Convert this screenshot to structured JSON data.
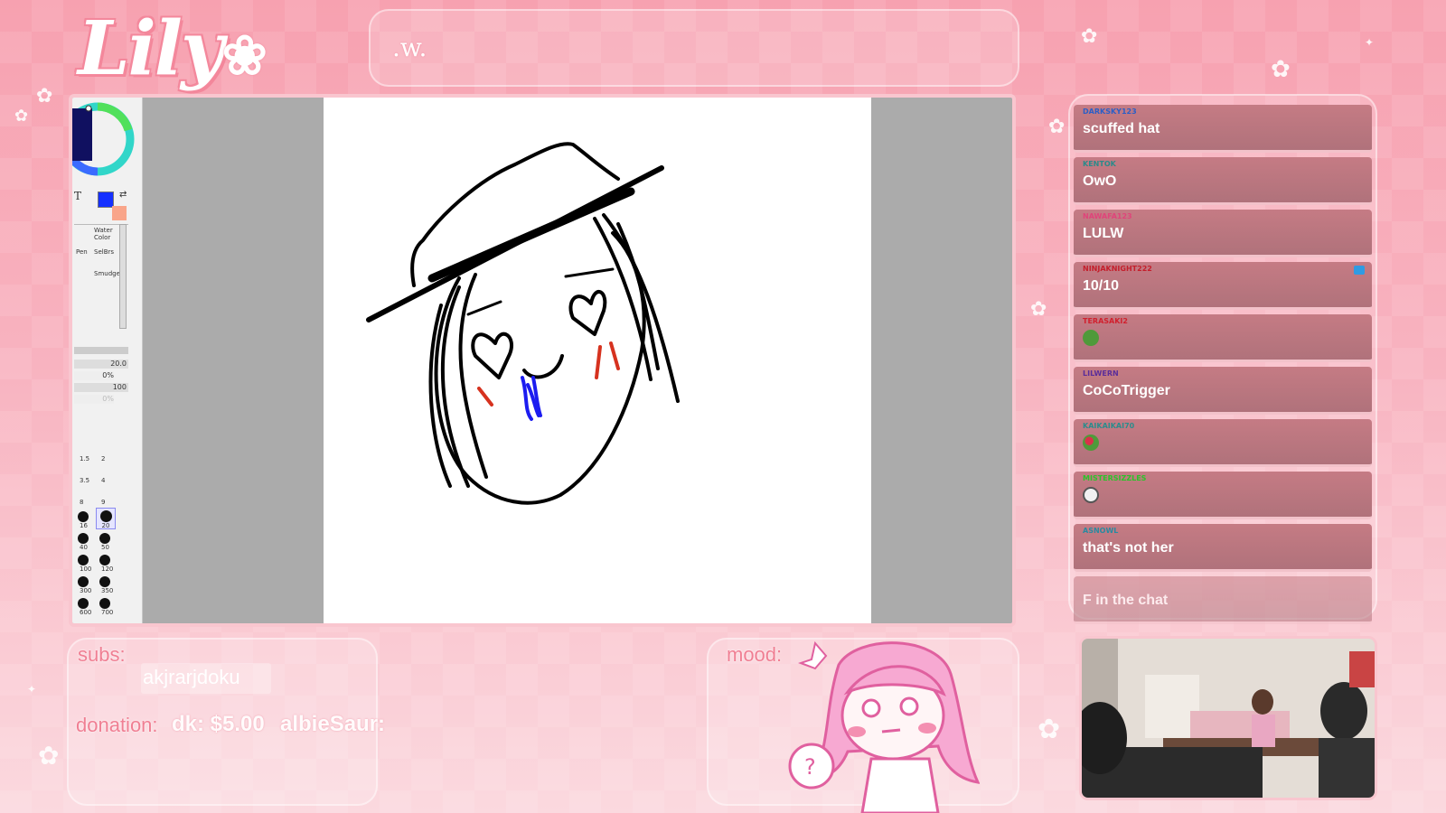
{
  "overlay": {
    "logo_text": "Lily",
    "title_text": ".w.",
    "subs_label": "subs:",
    "latest_sub": "akjrarjdoku",
    "donation_label": "donation:",
    "donation_entry": "dk: $5.00",
    "donation_entry_2": "albieSaur:",
    "mood_label": "mood:",
    "mood_bubble": "?"
  },
  "paint_app": {
    "tools": [
      "T",
      "Water Color",
      "Pen",
      "SelBrs",
      "Smudge"
    ],
    "brush_size": "20.0",
    "density": "100",
    "opacity_1": "0%",
    "opacity_2": "0%",
    "brush_sizes": [
      "1.5",
      "2",
      "3.5",
      "4",
      "8",
      "9",
      "16",
      "20",
      "40",
      "50",
      "100",
      "120",
      "300",
      "350",
      "600",
      "700"
    ],
    "primary_color": "#1530ff",
    "secondary_color": "#f9a58a"
  },
  "chat": {
    "messages": [
      {
        "user": "DARKSKY123",
        "text": "scuffed hat",
        "user_color": "#2b5fc7"
      },
      {
        "user": "KENTOK",
        "text": "OwO",
        "user_color": "#2b8a8a"
      },
      {
        "user": "NAWAFA123",
        "text": "LULW",
        "user_color": "#e0447a"
      },
      {
        "user": "NINJAKNIGHT222",
        "text": "10/10",
        "user_color": "#c41f2c"
      },
      {
        "user": "TERASAKI2",
        "text": "",
        "user_color": "#d1202e",
        "emote": "pepe-emote"
      },
      {
        "user": "LILWERN",
        "text": "CoCoTrigger",
        "user_color": "#5a2d9a"
      },
      {
        "user": "KAIKAIKAI70",
        "text": "",
        "user_color": "#2c8c8c",
        "emote": "pepe-rose-emote"
      },
      {
        "user": "MISTERSIZZLES",
        "text": "",
        "user_color": "#2ac42a",
        "emote": "white-face-emote"
      },
      {
        "user": "ASNOWL",
        "text": "that's not her",
        "user_color": "#2a8aa0"
      },
      {
        "user": "",
        "text": "F in the chat",
        "user_color": "#2a8aa0"
      }
    ]
  },
  "colors": {
    "accent": "#f07f93",
    "chat_bg": "#b9767f"
  }
}
